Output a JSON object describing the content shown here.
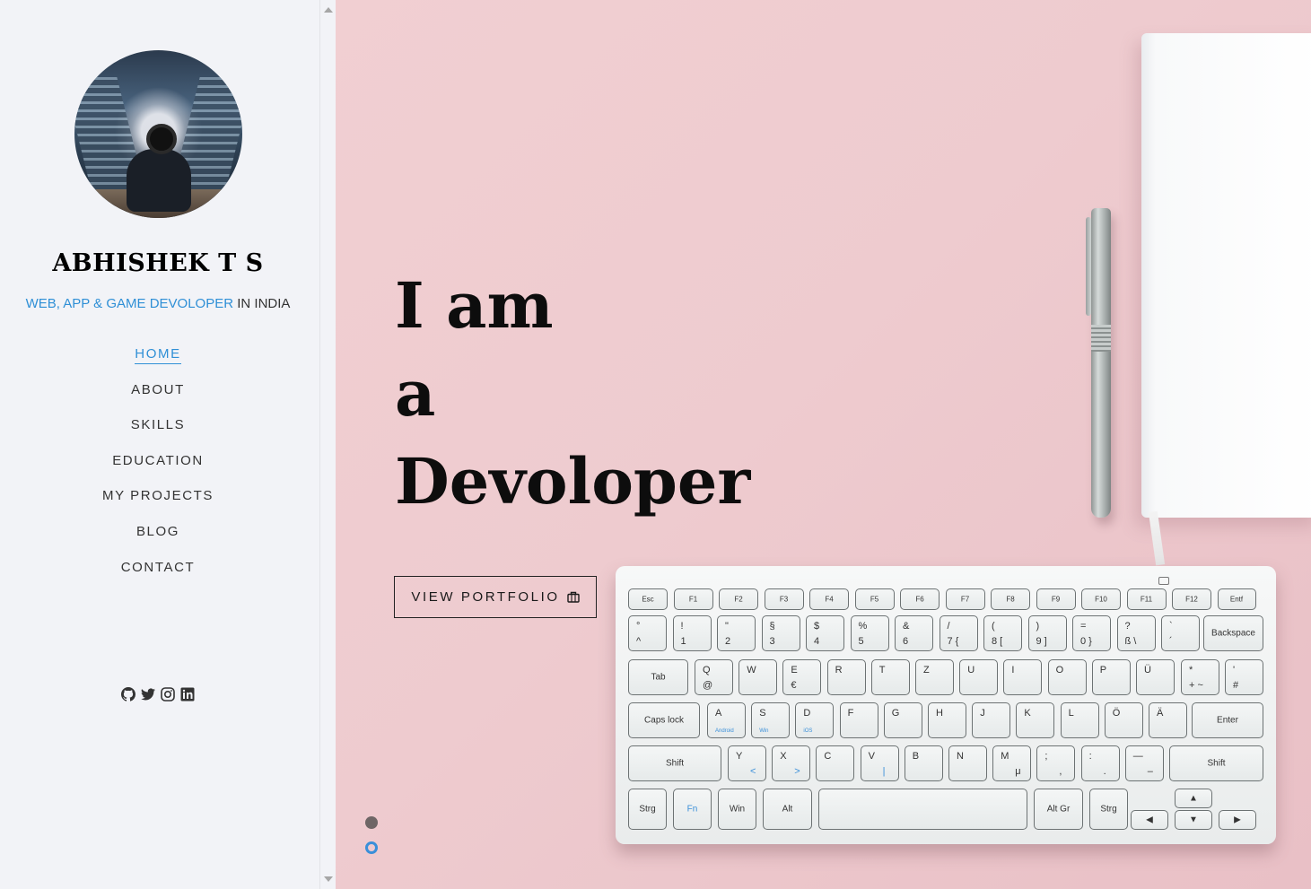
{
  "profile": {
    "name": "ABHISHEK T S",
    "tagline_accent": "WEB, APP & GAME DEVOLOPER",
    "tagline_rest": " IN INDIA"
  },
  "nav": {
    "items": [
      "HOME",
      "ABOUT",
      "SKILLS",
      "EDUCATION",
      "MY PROJECTS",
      "BLOG",
      "CONTACT"
    ],
    "active": "HOME"
  },
  "socials": [
    "github-icon",
    "twitter-icon",
    "instagram-icon",
    "linkedin-icon"
  ],
  "hero": {
    "line1": "I am",
    "line2": "a",
    "line3": "Devoloper",
    "cta_label": "VIEW PORTFOLIO"
  },
  "keyboard": {
    "function_row": [
      "Esc",
      "F1",
      "F2",
      "F3",
      "F4",
      "F5",
      "F6",
      "F7",
      "F8",
      "F9",
      "F10",
      "F11",
      "F12",
      "Entf"
    ],
    "row1": [
      {
        "top": "°",
        "bottom": "^"
      },
      {
        "top": "!",
        "bottom": "1"
      },
      {
        "top": "\"",
        "bottom": "2"
      },
      {
        "top": "§",
        "bottom": "3"
      },
      {
        "top": "$",
        "bottom": "4"
      },
      {
        "top": "%",
        "bottom": "5"
      },
      {
        "top": "&",
        "bottom": "6"
      },
      {
        "top": "/",
        "bottom": "7 {"
      },
      {
        "top": "(",
        "bottom": "8 ["
      },
      {
        "top": ")",
        "bottom": "9 ]"
      },
      {
        "top": "=",
        "bottom": "0 }"
      },
      {
        "top": "?",
        "bottom": "ß \\"
      },
      {
        "top": "`",
        "bottom": "´"
      }
    ],
    "backspace": "Backspace",
    "tab": "Tab",
    "row2": [
      "Q",
      "W",
      "E",
      "R",
      "T",
      "Z",
      "U",
      "I",
      "O",
      "P",
      "Ü"
    ],
    "row2_subs": [
      "@",
      "",
      "€",
      "",
      "",
      "",
      "",
      "",
      "",
      "",
      ""
    ],
    "plus_key": {
      "top": "*",
      "bottom": "+ ~"
    },
    "hash_key": {
      "top": "'",
      "bottom": "#"
    },
    "caps": "Caps lock",
    "row3": [
      "A",
      "S",
      "D",
      "F",
      "G",
      "H",
      "J",
      "K",
      "L",
      "Ö",
      "Ä"
    ],
    "row3_subs": [
      "Android",
      "Win",
      "iOS",
      "",
      "",
      "",
      "",
      "",
      "",
      "",
      ""
    ],
    "enter": "Enter",
    "shift_left": "Shift",
    "row4": [
      "Y",
      "X",
      "C",
      "V",
      "B",
      "N",
      "M",
      ";",
      ":",
      "—"
    ],
    "row4_subs": [
      "<",
      ">",
      "",
      "|",
      "",
      "",
      "μ",
      ",",
      ".",
      "–"
    ],
    "shift_right": "Shift",
    "bottom_row": [
      "Strg",
      "Fn",
      "Win",
      "Alt",
      "",
      "Alt Gr",
      "Strg"
    ]
  },
  "slider": {
    "total": 2,
    "active_index": 1
  },
  "colors": {
    "accent": "#2f8fd6",
    "hero_bg": "#eecbcf",
    "sidebar_bg": "#f2f3f7"
  }
}
